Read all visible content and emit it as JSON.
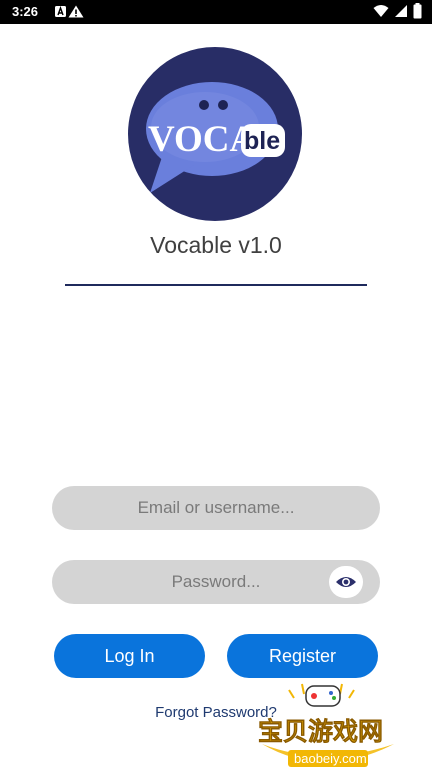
{
  "status_bar": {
    "time": "3:26",
    "left_icons": [
      "notification-a-icon",
      "warning-icon"
    ],
    "right_icons": [
      "wifi-icon",
      "cell-signal-icon",
      "battery-icon"
    ]
  },
  "logo": {
    "text_main": "VOCA",
    "text_tag": "ble",
    "circle_color": "#282d66",
    "bubble_color": "#6a7fdc"
  },
  "app": {
    "title": "Vocable v1.0"
  },
  "form": {
    "email_placeholder": "Email or username...",
    "password_placeholder": "Password...",
    "eye_icon": "eye-icon"
  },
  "buttons": {
    "login_label": "Log In",
    "register_label": "Register",
    "accent_color": "#0a74dc"
  },
  "links": {
    "forgot_password": "Forgot Password?"
  },
  "watermark": {
    "text_cn": "宝贝游戏网",
    "text_url": "baobeiy.com"
  }
}
